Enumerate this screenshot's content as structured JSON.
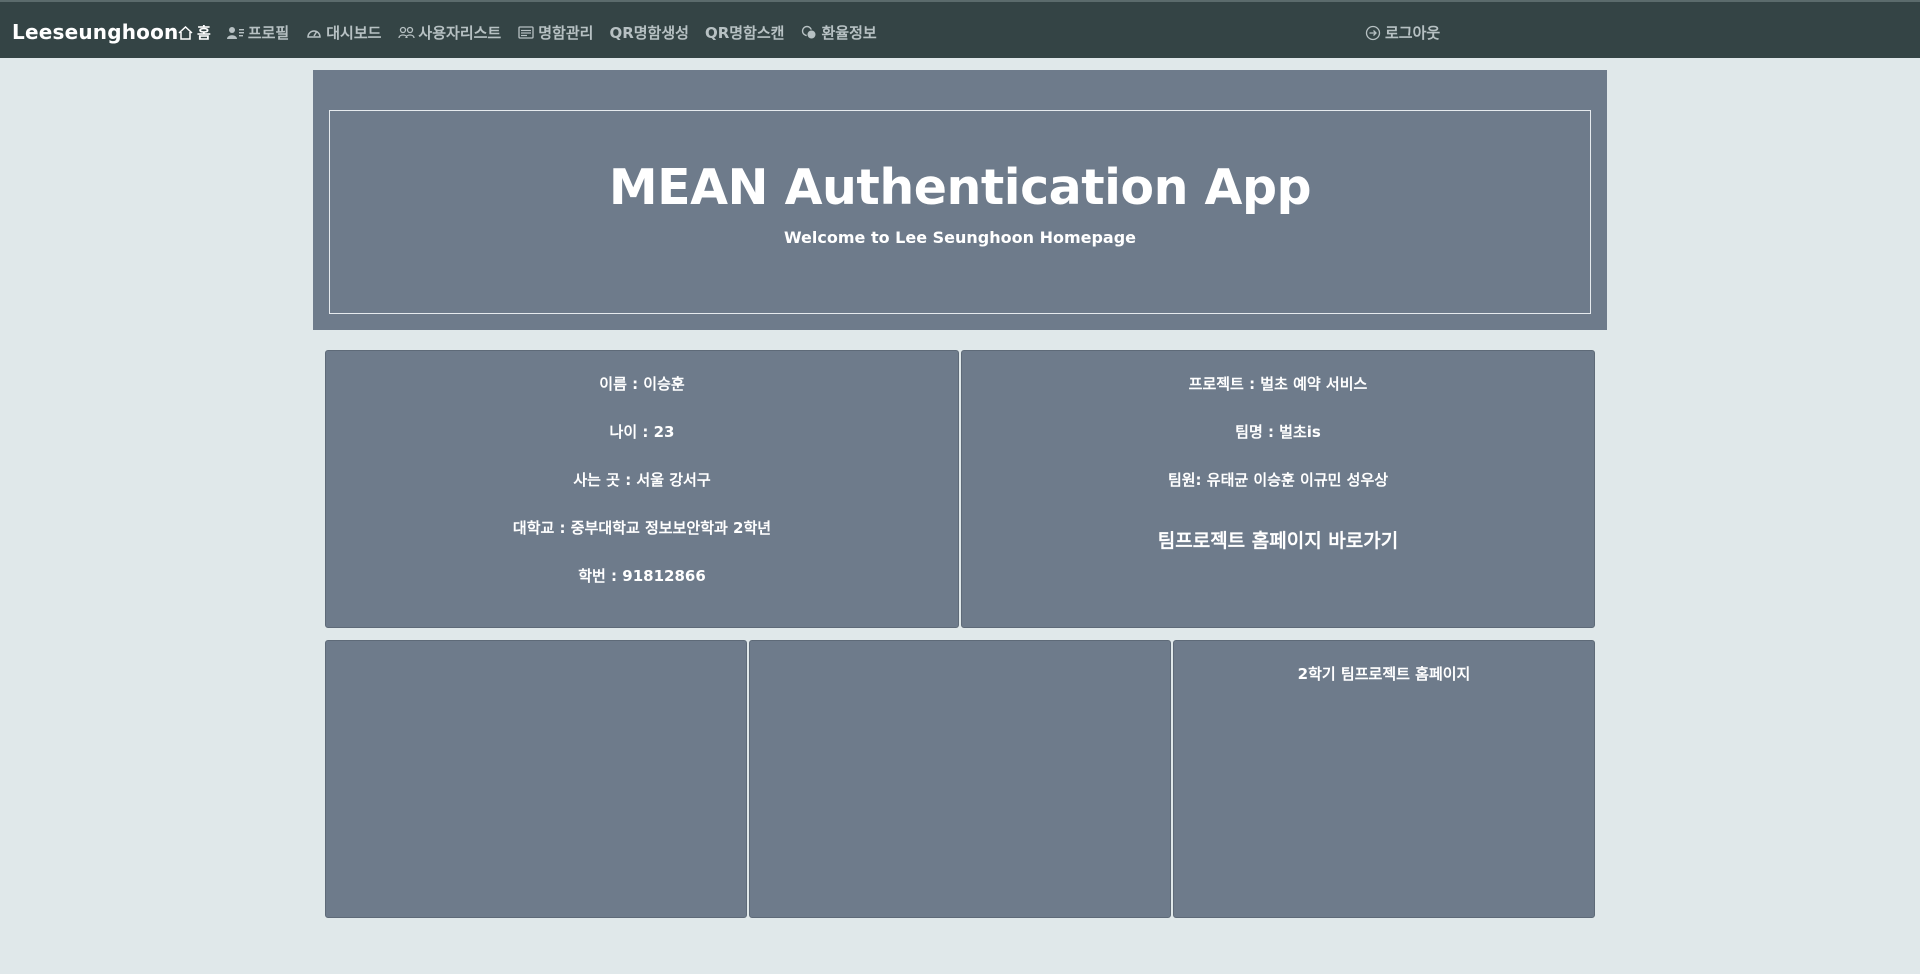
{
  "navbar": {
    "brand": "Leeseunghoon",
    "items": [
      {
        "label": "홈",
        "icon": "home-icon"
      },
      {
        "label": "프로필",
        "icon": "user-icon"
      },
      {
        "label": "대시보드",
        "icon": "dashboard-icon"
      },
      {
        "label": "사용자리스트",
        "icon": "users-icon"
      },
      {
        "label": "명함관리",
        "icon": "card-icon"
      },
      {
        "label": "QR명함생성",
        "icon": ""
      },
      {
        "label": "QR명함스캔",
        "icon": ""
      },
      {
        "label": "환율정보",
        "icon": "coins-icon"
      }
    ],
    "logout": {
      "label": "로그아웃",
      "icon": "logout-icon"
    }
  },
  "jumbotron": {
    "title": "MEAN Authentication App",
    "subtitle": "Welcome to Lee Seunghoon Homepage"
  },
  "profile_card": {
    "lines": [
      "이름 : 이승훈",
      "나이 : 23",
      "사는 곳 : 서울 강서구",
      "대학교 : 중부대학교 정보보안학과 2학년",
      "학번 : 91812866"
    ]
  },
  "project_card": {
    "lines": [
      "프로젝트 : 벌초 예약 서비스",
      "팀명 : 벌초is",
      "팀원: 유태균 이승훈 이규민 성우상"
    ],
    "link": "팀프로젝트 홈페이지 바로가기"
  },
  "bottom_cards": {
    "third_title": "2학기 팀프로젝트 홈페이지"
  },
  "colors": {
    "navbar_bg": "#344445",
    "page_bg": "#e0e8ea",
    "panel_bg": "#6e7b8b"
  }
}
